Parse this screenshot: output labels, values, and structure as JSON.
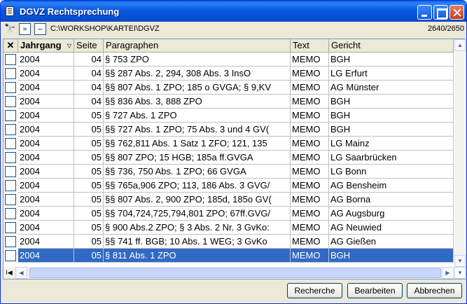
{
  "window": {
    "title": "DGVZ Rechtsprechung"
  },
  "toolbar": {
    "binoculars": "🔭",
    "forward_label": "»",
    "swap_label": "⇔",
    "path": "C:\\WORKSHOP\\KARTEI\\DGVZ",
    "record_count": "2640/2650"
  },
  "grid": {
    "clear_label": "✕",
    "sort_marker": "▽",
    "columns": [
      {
        "label": "Jahrgang",
        "bold": true
      },
      {
        "label": "Seite"
      },
      {
        "label": "Paragraphen"
      },
      {
        "label": "Text"
      },
      {
        "label": "Gericht"
      }
    ],
    "rows": [
      {
        "jahrgang": "2004",
        "seite": "04",
        "paragraphen": "§ 753 ZPO",
        "text": "MEMO",
        "gericht": "BGH"
      },
      {
        "jahrgang": "2004",
        "seite": "04",
        "paragraphen": "§§ 287 Abs. 2, 294, 308 Abs. 3 InsO",
        "text": "MEMO",
        "gericht": "LG Erfurt"
      },
      {
        "jahrgang": "2004",
        "seite": "04",
        "paragraphen": "§§ 807 Abs. 1 ZPO; 185 o GVGA; § 9,KV",
        "text": "MEMO",
        "gericht": "AG Münster"
      },
      {
        "jahrgang": "2004",
        "seite": "04",
        "paragraphen": "§§ 836 Abs. 3, 888 ZPO",
        "text": "MEMO",
        "gericht": "BGH"
      },
      {
        "jahrgang": "2004",
        "seite": "05",
        "paragraphen": "§ 727 Abs. 1 ZPO",
        "text": "MEMO",
        "gericht": "BGH"
      },
      {
        "jahrgang": "2004",
        "seite": "05",
        "paragraphen": "§§ 727 Abs. 1 ZPO; 75 Abs. 3 und 4 GV(",
        "text": "MEMO",
        "gericht": "BGH"
      },
      {
        "jahrgang": "2004",
        "seite": "05",
        "paragraphen": "§§ 762,811 Abs. 1 Satz 1 ZFO; 121, 135",
        "text": "MEMO",
        "gericht": "LG Mainz"
      },
      {
        "jahrgang": "2004",
        "seite": "05",
        "paragraphen": "§§ 807 ZPO; 15 HGB; 185a ff.GVGA",
        "text": "MEMO",
        "gericht": "LG Saarbrücken"
      },
      {
        "jahrgang": "2004",
        "seite": "05",
        "paragraphen": "§§ 736, 750 Abs. 1 ZPO; 66 GVGA",
        "text": "MEMO",
        "gericht": "LG Bonn"
      },
      {
        "jahrgang": "2004",
        "seite": "05",
        "paragraphen": "§§ 765a,906 ZPO; 113, 186 Abs. 3 GVG/",
        "text": "MEMO",
        "gericht": "AG Bensheim"
      },
      {
        "jahrgang": "2004",
        "seite": "05",
        "paragraphen": "§§ 807 Abs. 2, 900 ZPO; 185d, 185o GV(",
        "text": "MEMO",
        "gericht": "AG Borna"
      },
      {
        "jahrgang": "2004",
        "seite": "05",
        "paragraphen": "§§ 704,724,725,794,801 ZPO; 67ff.GVG/",
        "text": "MEMO",
        "gericht": "AG Augsburg"
      },
      {
        "jahrgang": "2004",
        "seite": "05",
        "paragraphen": "§ 900 Abs.2 ZPO; § 3 Abs. 2 Nr. 3 GvKo:",
        "text": "MEMO",
        "gericht": "AG Neuwied"
      },
      {
        "jahrgang": "2004",
        "seite": "05",
        "paragraphen": "§§ 741 ff. BGB; 10 Abs. 1 WEG; 3 GvKo",
        "text": "MEMO",
        "gericht": "AG Gießen"
      },
      {
        "jahrgang": "2004",
        "seite": "05",
        "paragraphen": "§ 811 Abs. 1 ZPO",
        "text": "MEMO",
        "gericht": "BGH",
        "selected": true
      }
    ],
    "first_record_label": "I◀"
  },
  "buttons": {
    "recherche": "Recherche",
    "bearbeiten": "Bearbeiten",
    "abbrechen": "Abbrechen"
  },
  "colors": {
    "selection": "#316ac5",
    "title_bar": "#0757e0"
  }
}
